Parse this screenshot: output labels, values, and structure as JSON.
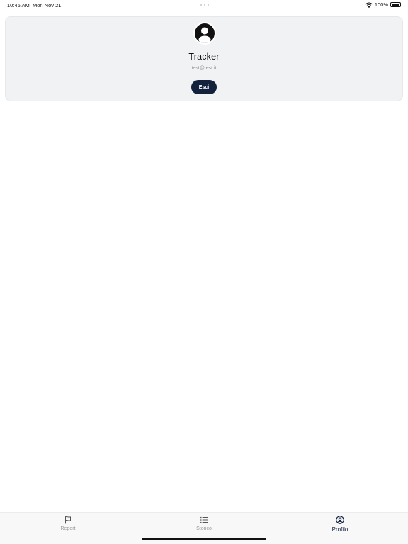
{
  "status_bar": {
    "time": "10:46 AM",
    "date": "Mon Nov 21",
    "battery_percent": "100%",
    "wifi_icon": "wifi-icon",
    "battery_icon": "battery-full-icon"
  },
  "profile": {
    "avatar_icon": "user-circle-icon",
    "name": "Tracker",
    "email": "test@test.it",
    "logout_label": "Esci"
  },
  "tabs": [
    {
      "label": "Report",
      "icon": "flag-icon",
      "active": false
    },
    {
      "label": "Storico",
      "icon": "list-icon",
      "active": false
    },
    {
      "label": "Profilo",
      "icon": "user-circle-icon",
      "active": true
    }
  ],
  "colors": {
    "accent": "#14213d",
    "card_background": "#f1f2f4",
    "inactive_tab": "#9a9a9a"
  }
}
